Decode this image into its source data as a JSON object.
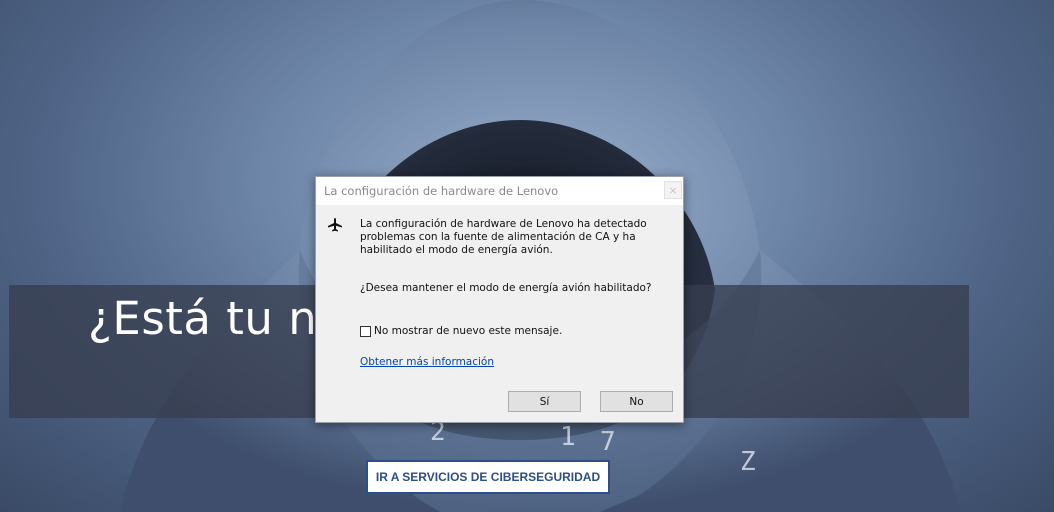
{
  "background": {
    "headline": "¿Está tu no                                  o frente a",
    "cta_label": "IR A SERVICIOS DE CIBERSEGURIDAD"
  },
  "dialog": {
    "title": "La configuración de hardware de Lenovo",
    "close_label": "×",
    "icon": "airplane-icon",
    "message": "La configuración de hardware de Lenovo ha detectado problemas con la fuente de alimentación de CA y ha habilitado el modo de energía avión.",
    "question": "¿Desea mantener el modo de energía avión habilitado?",
    "checkbox_label": "No mostrar de nuevo este mensaje.",
    "checkbox_checked": false,
    "link_text": "Obtener más información",
    "yes_label": "Sí",
    "no_label": "No"
  },
  "colors": {
    "link": "#0645ad",
    "cta_border": "#2b4f86",
    "dialog_bg": "#f0f0f0"
  }
}
